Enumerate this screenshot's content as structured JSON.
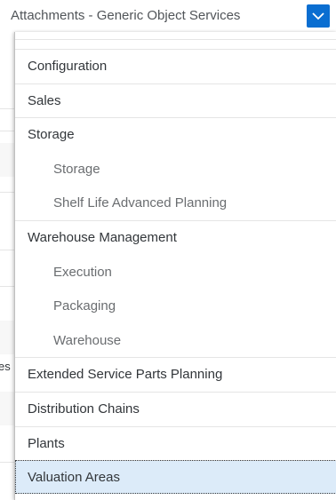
{
  "select": {
    "value": "Attachments - Generic Object Services",
    "arrow_icon": "chevron-down-icon",
    "accent_color": "#0a6ed1"
  },
  "background": {
    "fragment": "es"
  },
  "dropdown": {
    "items": [
      {
        "label": "Configuration",
        "level": "group",
        "selected": false
      },
      {
        "label": "Sales",
        "level": "group",
        "selected": false
      },
      {
        "label": "Storage",
        "level": "group",
        "selected": false
      },
      {
        "label": "Storage",
        "level": "sub",
        "selected": false
      },
      {
        "label": "Shelf Life Advanced Planning",
        "level": "sub",
        "selected": false
      },
      {
        "label": "Warehouse Management",
        "level": "group",
        "selected": false
      },
      {
        "label": "Execution",
        "level": "sub",
        "selected": false
      },
      {
        "label": "Packaging",
        "level": "sub",
        "selected": false
      },
      {
        "label": "Warehouse",
        "level": "sub",
        "selected": false
      },
      {
        "label": "Extended Service Parts Planning",
        "level": "group",
        "selected": false
      },
      {
        "label": "Distribution Chains",
        "level": "group",
        "selected": false
      },
      {
        "label": "Plants",
        "level": "group",
        "selected": false
      },
      {
        "label": "Valuation Areas",
        "level": "group",
        "selected": true
      }
    ],
    "selected_color": "#dcebf9"
  }
}
